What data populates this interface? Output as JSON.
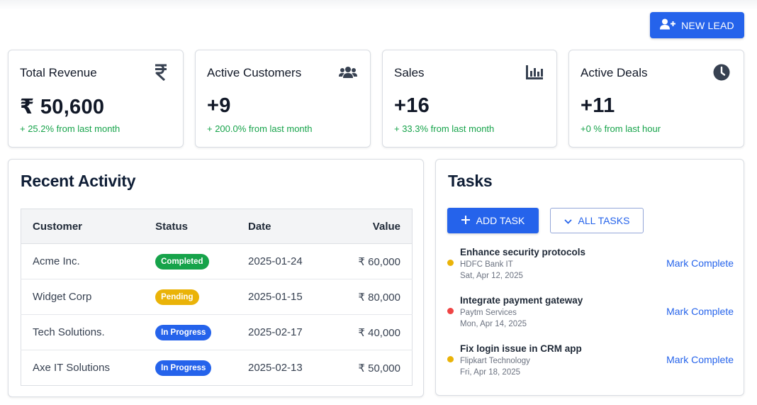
{
  "header": {
    "new_lead_label": "NEW LEAD"
  },
  "stats": [
    {
      "title": "Total Revenue",
      "icon": "rupee-icon",
      "value": "₹ 50,600",
      "change": "+ 25.2% from last month"
    },
    {
      "title": "Active Customers",
      "icon": "users-icon",
      "value": "+9",
      "change": "+ 200.0% from last month"
    },
    {
      "title": "Sales",
      "icon": "bar-chart-icon",
      "value": "+16",
      "change": "+ 33.3% from last month"
    },
    {
      "title": "Active Deals",
      "icon": "clock-icon",
      "value": "+11",
      "change": "+0 % from last hour"
    }
  ],
  "activity": {
    "title": "Recent Activity",
    "columns": [
      "Customer",
      "Status",
      "Date",
      "Value"
    ],
    "rows": [
      {
        "customer": "Acme Inc.",
        "status": "Completed",
        "status_color": "#16a34a",
        "date": "2025-01-24",
        "value": "₹ 60,000"
      },
      {
        "customer": "Widget Corp",
        "status": "Pending",
        "status_color": "#eab308",
        "date": "2025-01-15",
        "value": "₹ 80,000"
      },
      {
        "customer": "Tech Solutions.",
        "status": "In Progress",
        "status_color": "#2563eb",
        "date": "2025-02-17",
        "value": "₹ 40,000"
      },
      {
        "customer": "Axe IT Solutions",
        "status": "In Progress",
        "status_color": "#2563eb",
        "date": "2025-02-13",
        "value": "₹ 50,000"
      }
    ]
  },
  "tasks": {
    "title": "Tasks",
    "add_label": "ADD TASK",
    "all_label": "ALL TASKS",
    "items": [
      {
        "title": "Enhance security protocols",
        "org": "HDFC Bank IT",
        "date": "Sat, Apr 12, 2025",
        "priority_color": "#eab308",
        "action": "Mark Complete"
      },
      {
        "title": "Integrate payment gateway",
        "org": "Paytm Services",
        "date": "Mon, Apr 14, 2025",
        "priority_color": "#ef4444",
        "action": "Mark Complete"
      },
      {
        "title": "Fix login issue in CRM app",
        "org": "Flipkart Technology",
        "date": "Fri, Apr 18, 2025",
        "priority_color": "#eab308",
        "action": "Mark Complete"
      }
    ]
  },
  "colors": {
    "accent": "#2563eb",
    "positive": "#16a34a"
  }
}
